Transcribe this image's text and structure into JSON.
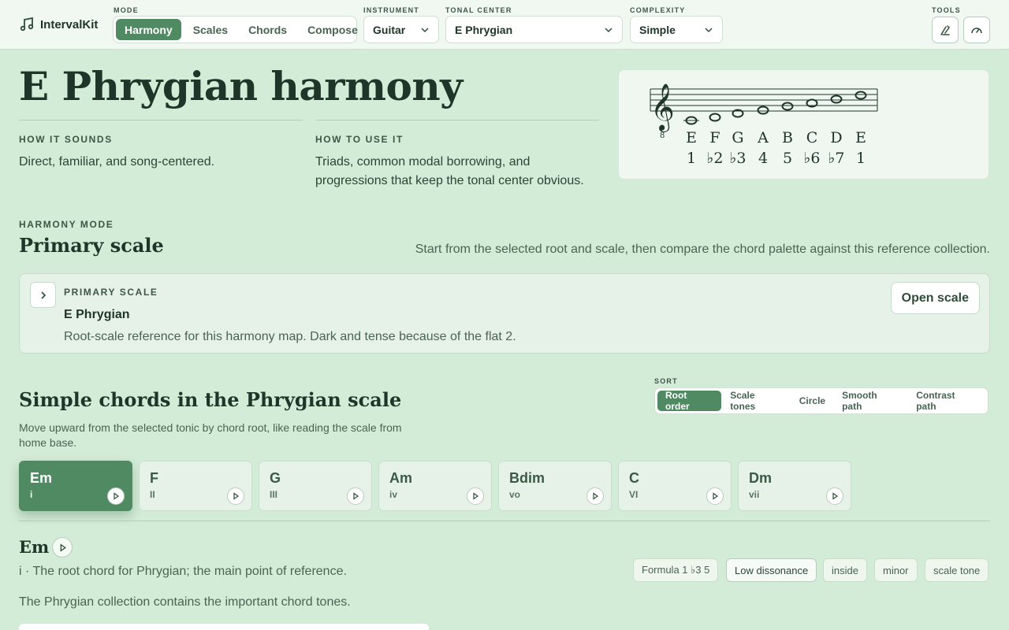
{
  "app": {
    "name": "IntervalKit"
  },
  "toolbar": {
    "mode_label": "MODE",
    "modes": [
      "Harmony",
      "Scales",
      "Chords",
      "Compose"
    ],
    "instrument_label": "INSTRUMENT",
    "instrument_value": "Guitar",
    "tonal_center_label": "TONAL CENTER",
    "tonal_center_value": "E Phrygian",
    "complexity_label": "COMPLEXITY",
    "complexity_value": "Simple",
    "tools_label": "TOOLS",
    "tools": [
      "tuning-fork-icon",
      "gauge-icon"
    ]
  },
  "hero": {
    "title": "E Phrygian harmony",
    "sounds_label": "HOW IT SOUNDS",
    "sounds_text": "Direct, familiar, and song-centered.",
    "use_label": "HOW TO USE IT",
    "use_text_1": "Triads, common modal borrowing, and",
    "use_text_2": "progressions that keep the tonal center obvious."
  },
  "staff": {
    "notes": [
      "E",
      "F",
      "G",
      "A",
      "B",
      "C",
      "D",
      "E"
    ],
    "degrees": [
      "1",
      "♭2",
      "♭3",
      "4",
      "5",
      "♭6",
      "♭7",
      "1"
    ]
  },
  "harmony": {
    "kicker": "HARMONY MODE",
    "title": "Primary scale",
    "hint": "Start from the selected root and scale, then compare the chord palette against this reference collection.",
    "card_label": "PRIMARY SCALE",
    "card_title": "E Phrygian",
    "card_desc": "Root-scale reference for this harmony map. Dark and tense because of the flat 2.",
    "open_button": "Open scale"
  },
  "chords": {
    "title": "Simple chords in the Phrygian scale",
    "desc_1": "Move upward from the selected tonic by chord root, like reading the scale from",
    "desc_2": "home base.",
    "sort_label": "SORT",
    "sort_options": [
      "Root order",
      "Scale tones",
      "Circle",
      "Smooth path",
      "Contrast path"
    ],
    "items": [
      {
        "name": "Em",
        "numeral": "i"
      },
      {
        "name": "F",
        "numeral": "II"
      },
      {
        "name": "G",
        "numeral": "III"
      },
      {
        "name": "Am",
        "numeral": "iv"
      },
      {
        "name": "Bdim",
        "numeral": "vo"
      },
      {
        "name": "C",
        "numeral": "VI"
      },
      {
        "name": "Dm",
        "numeral": "vii"
      }
    ]
  },
  "detail": {
    "name": "Em",
    "desc": "i · The root chord for Phrygian; the main point of reference.",
    "note": "The Phrygian collection contains the important chord tones.",
    "tags": [
      "Formula 1 ♭3 5",
      "Low dissonance",
      "inside",
      "minor",
      "scale tone"
    ]
  },
  "colors": {
    "accent": "#4f8a62",
    "background": "#d3ecd7",
    "surface": "#f1f7f1"
  }
}
